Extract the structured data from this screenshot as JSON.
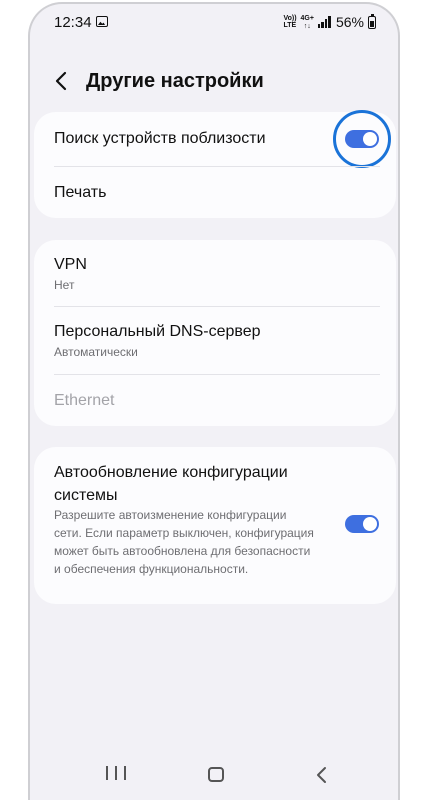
{
  "status_bar": {
    "time": "12:34",
    "volte_top": "Vo))",
    "volte_bottom": "LTE",
    "network": "4G+",
    "network_arrows": "↑↓",
    "battery": "56%",
    "icons": [
      "gallery-icon",
      "signal-icon",
      "battery-icon"
    ]
  },
  "header": {
    "title": "Другие настройки",
    "back_icon": "chevron-left-icon"
  },
  "settings": {
    "nearby": {
      "label": "Поиск устройств поблизости",
      "enabled": true
    },
    "print": {
      "label": "Печать"
    },
    "vpn": {
      "label": "VPN",
      "value": "Нет"
    },
    "dns": {
      "label": "Персональный DNS-сервер",
      "value": "Автоматически"
    },
    "ethernet": {
      "label": "Ethernet",
      "disabled": true
    },
    "auto_update": {
      "label": "Автообновление конфигурации системы",
      "description": "Разрешите автоизменение конфигурации сети. Если параметр выключен, конфигурация может быть автообновлена для безопасности и обеспечения функциональности.",
      "enabled": true
    }
  },
  "colors": {
    "background": "#f2f1f6",
    "card": "#fcfcfe",
    "toggle_on": "#3e6fe0",
    "highlight_ring": "#1a73d8",
    "disabled_text": "#a3a3a8"
  },
  "nav_bar": {
    "icons": [
      "recents-icon",
      "home-icon",
      "back-icon"
    ]
  }
}
